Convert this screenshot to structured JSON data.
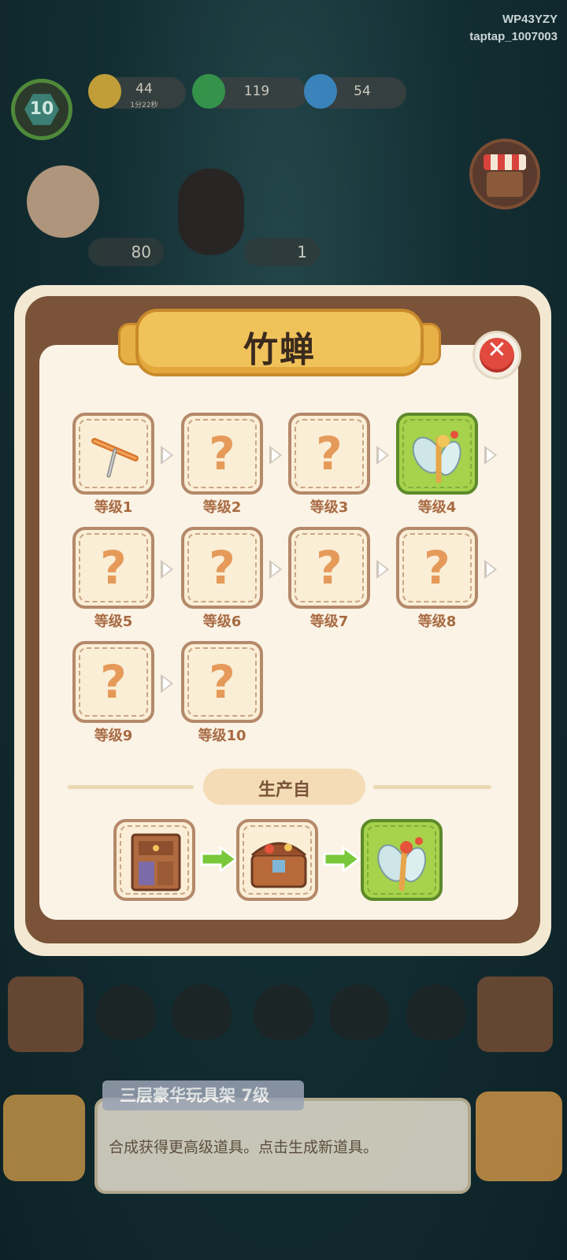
{
  "watermark": {
    "line1": "WP43YZY",
    "line2": "taptap_1007003"
  },
  "hud": {
    "player_level": "10",
    "energy": {
      "value": "44",
      "timer": "1分22秒"
    },
    "coins": {
      "value": "119"
    },
    "gems": {
      "value": "54"
    },
    "left_pill": "80",
    "right_pill": "1"
  },
  "modal": {
    "title": "竹蝉",
    "close_icon": "close-icon",
    "levels": [
      {
        "label": "等级1",
        "state": "known",
        "icon": "bamboo-stick-icon"
      },
      {
        "label": "等级2",
        "state": "unknown",
        "glyph": "?"
      },
      {
        "label": "等级3",
        "state": "unknown",
        "glyph": "?"
      },
      {
        "label": "等级4",
        "state": "current",
        "icon": "bamboo-dragonfly-icon"
      },
      {
        "label": "等级5",
        "state": "unknown",
        "glyph": "?"
      },
      {
        "label": "等级6",
        "state": "unknown",
        "glyph": "?"
      },
      {
        "label": "等级7",
        "state": "unknown",
        "glyph": "?"
      },
      {
        "label": "等级8",
        "state": "unknown",
        "glyph": "?"
      },
      {
        "label": "等级9",
        "state": "unknown",
        "glyph": "?"
      },
      {
        "label": "等级10",
        "state": "unknown",
        "glyph": "?"
      }
    ],
    "produced_from_label": "生产自",
    "production_chain": [
      {
        "icon": "toy-cabinet-icon"
      },
      {
        "icon": "toy-chest-icon"
      },
      {
        "icon": "bamboo-dragonfly-icon",
        "state": "current"
      }
    ]
  },
  "bottom_panel": {
    "title": "三层豪华玩具架  7级",
    "description": "合成获得更高级道具。点击生成新道具。"
  },
  "colors": {
    "tile_border": "#b4896a",
    "tile_current": "#a6d24c",
    "question_mark": "#e59a5a",
    "label": "#a86a42",
    "modal_frame": "#7a5339"
  }
}
